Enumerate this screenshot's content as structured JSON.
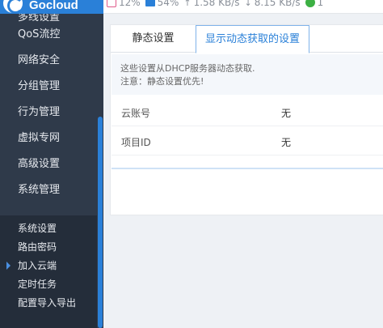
{
  "brand": {
    "name": "Gocloud"
  },
  "status": {
    "cpu": "12%",
    "memory": "54%",
    "upload": "1.58 KB/s",
    "download": "8.15 KB/s",
    "users": "1"
  },
  "sidebar": {
    "items": [
      {
        "label": "多线设置"
      },
      {
        "label": "QoS流控"
      },
      {
        "label": "网络安全"
      },
      {
        "label": "分组管理"
      },
      {
        "label": "行为管理"
      },
      {
        "label": "虚拟专网"
      },
      {
        "label": "高级设置"
      },
      {
        "label": "系统管理"
      }
    ],
    "submenu": [
      {
        "label": "系统设置"
      },
      {
        "label": "路由密码"
      },
      {
        "label": "加入云端",
        "active": true
      },
      {
        "label": "定时任务"
      },
      {
        "label": "配置导入导出"
      }
    ]
  },
  "tabs": {
    "static": "静态设置",
    "dynamic": "显示动态获取的设置"
  },
  "notice": {
    "line1": "这些设置从DHCP服务器动态获取.",
    "line2": "注意：静态设置优先!"
  },
  "rows": [
    {
      "key": "云账号",
      "value": "无"
    },
    {
      "key": "项目ID",
      "value": "无"
    }
  ],
  "colors": {
    "brand": "#2a80d8",
    "sidebar": "#2f3a4a",
    "active_tab": "#2a80d8"
  }
}
